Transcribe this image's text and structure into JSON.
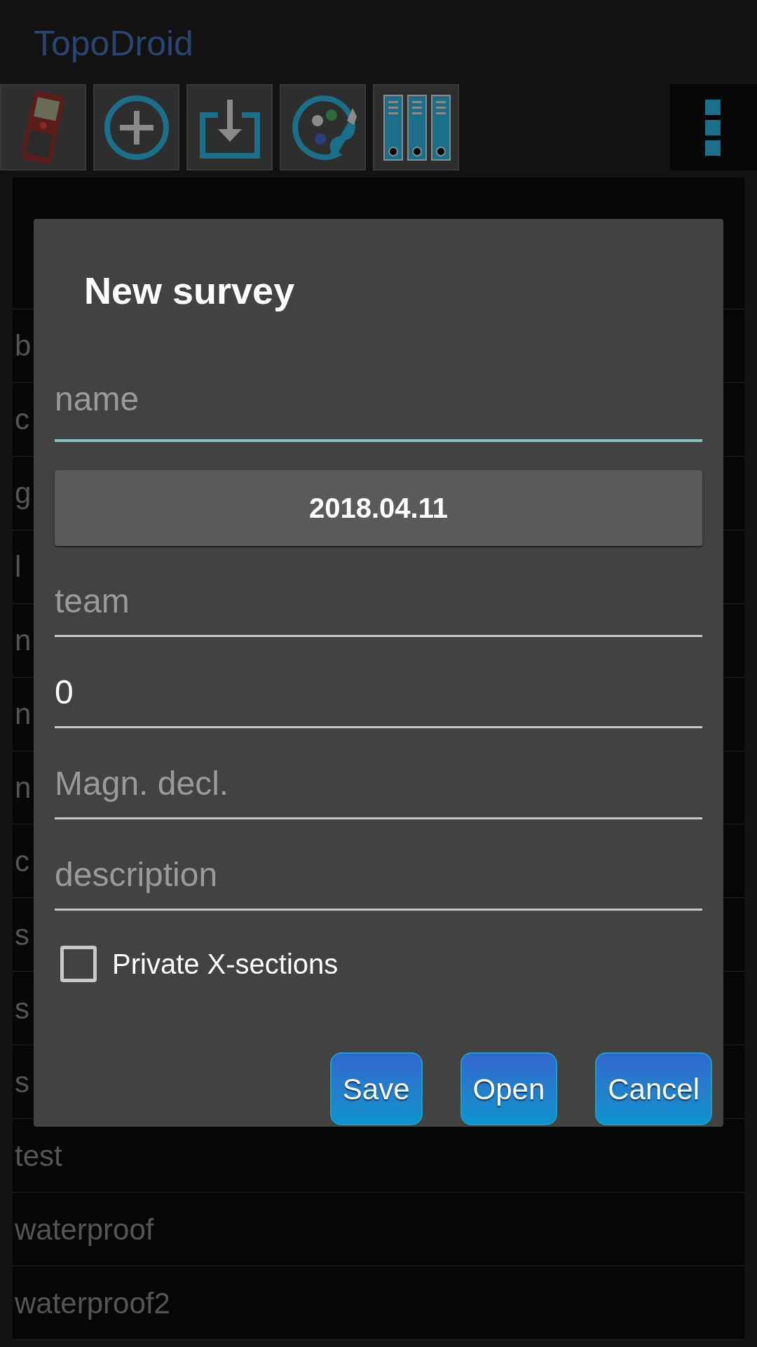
{
  "app_title": "TopoDroid",
  "surveys": [
    "b",
    "c",
    "g",
    "l",
    "n",
    "n",
    "n",
    "c",
    "s",
    "s",
    "s",
    "test",
    "waterproof",
    "waterproof2"
  ],
  "dialog": {
    "title": "New survey",
    "fields": [
      {
        "kind": "input",
        "placeholder": "name",
        "focused": true
      },
      {
        "kind": "date",
        "value": "2018.04.11"
      },
      {
        "kind": "input",
        "placeholder": "team",
        "focused": false
      },
      {
        "kind": "input",
        "value": "0",
        "focused": false
      },
      {
        "kind": "input",
        "placeholder": "Magn. decl.",
        "focused": false
      },
      {
        "kind": "input",
        "placeholder": "description",
        "focused": false
      }
    ],
    "checkbox": {
      "label": "Private X-sections",
      "checked": false
    },
    "buttons": [
      "Save",
      "Open",
      "Cancel"
    ]
  }
}
